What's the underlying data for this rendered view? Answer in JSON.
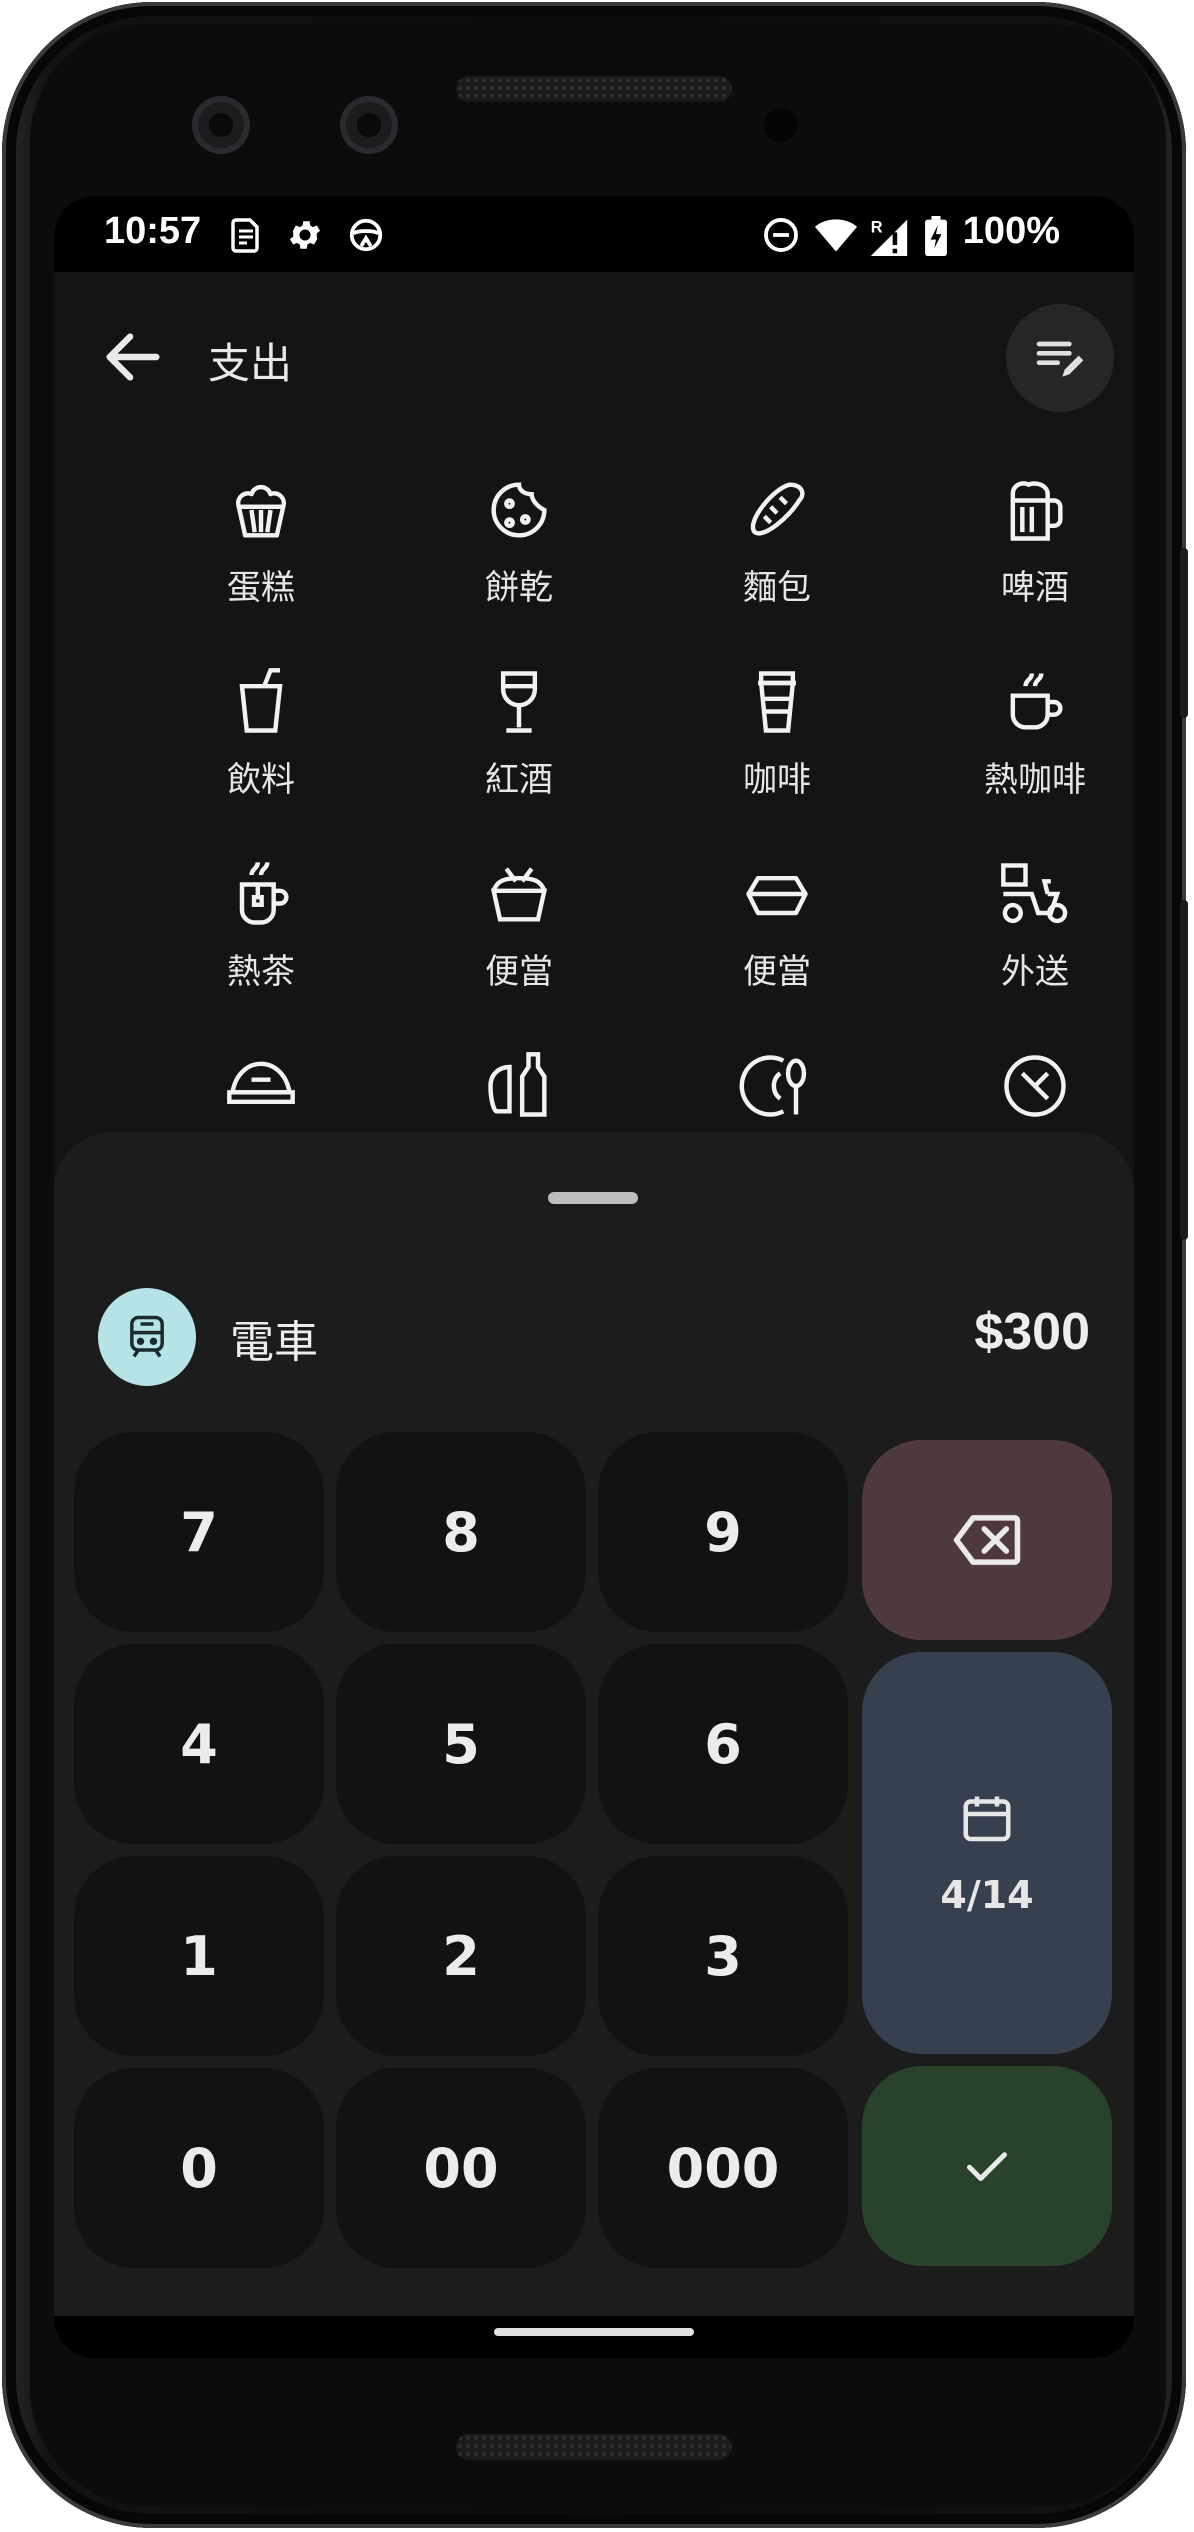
{
  "status_bar": {
    "time": "10:57",
    "battery_percent": "100%",
    "icons": [
      "sim-card-icon",
      "gear-icon",
      "vpn-steering-icon",
      "do-not-disturb-icon",
      "wifi-icon",
      "signal-roaming-icon",
      "battery-charging-icon"
    ]
  },
  "app_bar": {
    "title": "支出",
    "back_icon": "arrow-back-icon",
    "action_icon": "edit-list-icon"
  },
  "categories": [
    {
      "label": "蛋糕",
      "icon": "cupcake-icon"
    },
    {
      "label": "餅乾",
      "icon": "cookie-icon"
    },
    {
      "label": "麵包",
      "icon": "bread-icon"
    },
    {
      "label": "啤酒",
      "icon": "beer-icon"
    },
    {
      "label": "飲料",
      "icon": "cup-drink-icon"
    },
    {
      "label": "紅酒",
      "icon": "wine-glass-icon"
    },
    {
      "label": "咖啡",
      "icon": "coffee-takeaway-icon"
    },
    {
      "label": "熱咖啡",
      "icon": "hot-coffee-icon"
    },
    {
      "label": "熱茶",
      "icon": "hot-tea-icon"
    },
    {
      "label": "便當",
      "icon": "bento-icon"
    },
    {
      "label": "便當",
      "icon": "lunchbox-icon"
    },
    {
      "label": "外送",
      "icon": "delivery-scooter-icon"
    },
    {
      "label": "",
      "icon": "pet-bowl-icon"
    },
    {
      "label": "",
      "icon": "food-drink-icon"
    },
    {
      "label": "",
      "icon": "plate-spoon-icon"
    },
    {
      "label": "",
      "icon": "restaurant-icon"
    }
  ],
  "selected": {
    "name": "電車",
    "amount": "$300",
    "icon": "train-icon",
    "icon_bg": "#b6e3e6"
  },
  "keypad": {
    "keys": [
      "7",
      "8",
      "9",
      "4",
      "5",
      "6",
      "1",
      "2",
      "3",
      "0",
      "00",
      "000"
    ],
    "date": "4/14",
    "backspace_icon": "backspace-icon",
    "calendar_icon": "calendar-icon",
    "confirm_icon": "check-icon",
    "colors": {
      "backspace": "#4e3a3c",
      "date": "#37404f",
      "confirm": "#29432a"
    }
  }
}
